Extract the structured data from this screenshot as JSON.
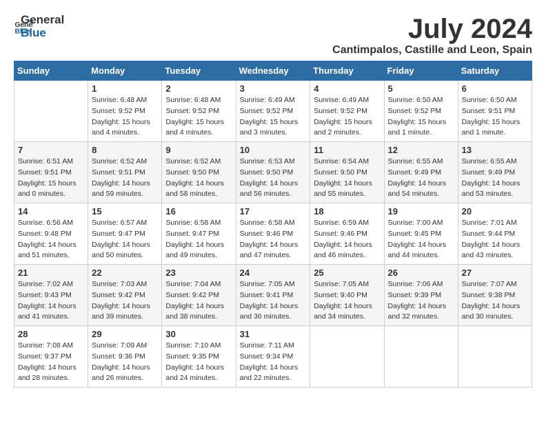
{
  "logo": {
    "line1": "General",
    "line2": "Blue"
  },
  "title": "July 2024",
  "location": "Cantimpalos, Castille and Leon, Spain",
  "days_of_week": [
    "Sunday",
    "Monday",
    "Tuesday",
    "Wednesday",
    "Thursday",
    "Friday",
    "Saturday"
  ],
  "weeks": [
    [
      {
        "day": "",
        "info": ""
      },
      {
        "day": "1",
        "info": "Sunrise: 6:48 AM\nSunset: 9:52 PM\nDaylight: 15 hours\nand 4 minutes."
      },
      {
        "day": "2",
        "info": "Sunrise: 6:48 AM\nSunset: 9:52 PM\nDaylight: 15 hours\nand 4 minutes."
      },
      {
        "day": "3",
        "info": "Sunrise: 6:49 AM\nSunset: 9:52 PM\nDaylight: 15 hours\nand 3 minutes."
      },
      {
        "day": "4",
        "info": "Sunrise: 6:49 AM\nSunset: 9:52 PM\nDaylight: 15 hours\nand 2 minutes."
      },
      {
        "day": "5",
        "info": "Sunrise: 6:50 AM\nSunset: 9:52 PM\nDaylight: 15 hours\nand 1 minute."
      },
      {
        "day": "6",
        "info": "Sunrise: 6:50 AM\nSunset: 9:51 PM\nDaylight: 15 hours\nand 1 minute."
      }
    ],
    [
      {
        "day": "7",
        "info": "Sunrise: 6:51 AM\nSunset: 9:51 PM\nDaylight: 15 hours\nand 0 minutes."
      },
      {
        "day": "8",
        "info": "Sunrise: 6:52 AM\nSunset: 9:51 PM\nDaylight: 14 hours\nand 59 minutes."
      },
      {
        "day": "9",
        "info": "Sunrise: 6:52 AM\nSunset: 9:50 PM\nDaylight: 14 hours\nand 58 minutes."
      },
      {
        "day": "10",
        "info": "Sunrise: 6:53 AM\nSunset: 9:50 PM\nDaylight: 14 hours\nand 56 minutes."
      },
      {
        "day": "11",
        "info": "Sunrise: 6:54 AM\nSunset: 9:50 PM\nDaylight: 14 hours\nand 55 minutes."
      },
      {
        "day": "12",
        "info": "Sunrise: 6:55 AM\nSunset: 9:49 PM\nDaylight: 14 hours\nand 54 minutes."
      },
      {
        "day": "13",
        "info": "Sunrise: 6:55 AM\nSunset: 9:49 PM\nDaylight: 14 hours\nand 53 minutes."
      }
    ],
    [
      {
        "day": "14",
        "info": "Sunrise: 6:56 AM\nSunset: 9:48 PM\nDaylight: 14 hours\nand 51 minutes."
      },
      {
        "day": "15",
        "info": "Sunrise: 6:57 AM\nSunset: 9:47 PM\nDaylight: 14 hours\nand 50 minutes."
      },
      {
        "day": "16",
        "info": "Sunrise: 6:58 AM\nSunset: 9:47 PM\nDaylight: 14 hours\nand 49 minutes."
      },
      {
        "day": "17",
        "info": "Sunrise: 6:58 AM\nSunset: 9:46 PM\nDaylight: 14 hours\nand 47 minutes."
      },
      {
        "day": "18",
        "info": "Sunrise: 6:59 AM\nSunset: 9:46 PM\nDaylight: 14 hours\nand 46 minutes."
      },
      {
        "day": "19",
        "info": "Sunrise: 7:00 AM\nSunset: 9:45 PM\nDaylight: 14 hours\nand 44 minutes."
      },
      {
        "day": "20",
        "info": "Sunrise: 7:01 AM\nSunset: 9:44 PM\nDaylight: 14 hours\nand 43 minutes."
      }
    ],
    [
      {
        "day": "21",
        "info": "Sunrise: 7:02 AM\nSunset: 9:43 PM\nDaylight: 14 hours\nand 41 minutes."
      },
      {
        "day": "22",
        "info": "Sunrise: 7:03 AM\nSunset: 9:42 PM\nDaylight: 14 hours\nand 39 minutes."
      },
      {
        "day": "23",
        "info": "Sunrise: 7:04 AM\nSunset: 9:42 PM\nDaylight: 14 hours\nand 38 minutes."
      },
      {
        "day": "24",
        "info": "Sunrise: 7:05 AM\nSunset: 9:41 PM\nDaylight: 14 hours\nand 36 minutes."
      },
      {
        "day": "25",
        "info": "Sunrise: 7:05 AM\nSunset: 9:40 PM\nDaylight: 14 hours\nand 34 minutes."
      },
      {
        "day": "26",
        "info": "Sunrise: 7:06 AM\nSunset: 9:39 PM\nDaylight: 14 hours\nand 32 minutes."
      },
      {
        "day": "27",
        "info": "Sunrise: 7:07 AM\nSunset: 9:38 PM\nDaylight: 14 hours\nand 30 minutes."
      }
    ],
    [
      {
        "day": "28",
        "info": "Sunrise: 7:08 AM\nSunset: 9:37 PM\nDaylight: 14 hours\nand 28 minutes."
      },
      {
        "day": "29",
        "info": "Sunrise: 7:09 AM\nSunset: 9:36 PM\nDaylight: 14 hours\nand 26 minutes."
      },
      {
        "day": "30",
        "info": "Sunrise: 7:10 AM\nSunset: 9:35 PM\nDaylight: 14 hours\nand 24 minutes."
      },
      {
        "day": "31",
        "info": "Sunrise: 7:11 AM\nSunset: 9:34 PM\nDaylight: 14 hours\nand 22 minutes."
      },
      {
        "day": "",
        "info": ""
      },
      {
        "day": "",
        "info": ""
      },
      {
        "day": "",
        "info": ""
      }
    ]
  ]
}
